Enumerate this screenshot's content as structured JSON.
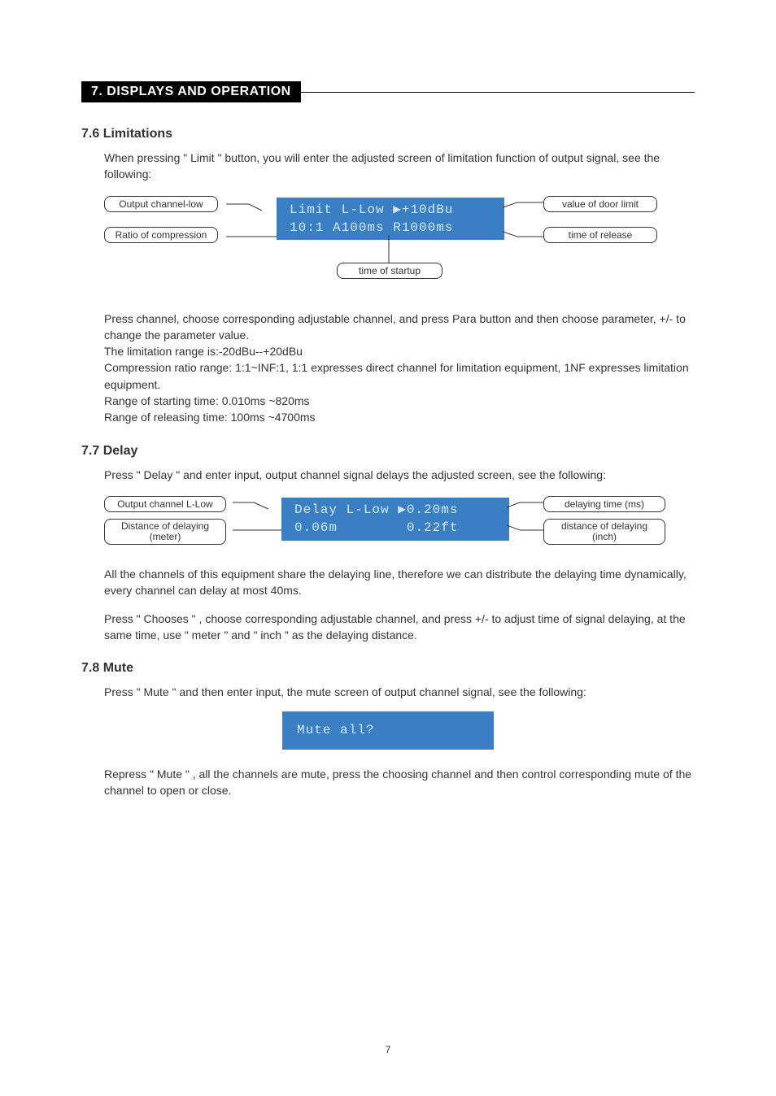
{
  "section_header": "7. DISPLAYS AND OPERATION",
  "limitations": {
    "title": "7.6 Limitations",
    "intro": "When pressing \" Limit \" button, you will enter the adjusted screen of limitation function of output signal, see the following:",
    "labels": {
      "out_channel": "Output channel-low",
      "ratio_comp": "Ratio of compression",
      "door_limit": "value of door limit",
      "time_release": "time of release",
      "time_startup": "time of startup"
    },
    "lcd_line1": "Limit L-Low ▶+10dBu",
    "lcd_line2": "10:1 A100ms R1000ms",
    "explain": "Press channel, choose corresponding adjustable channel, and press Para button and then choose parameter, +/- to change the parameter value.\nThe limitation range is:-20dBu--+20dBu\nCompression ratio range: 1:1~INF:1, 1:1 expresses direct channel for limitation equipment, 1NF expresses limitation equipment.\nRange of starting time: 0.010ms ~820ms\nRange of releasing time: 100ms ~4700ms"
  },
  "delay": {
    "title": "7.7 Delay",
    "intro": "Press \" Delay \" and enter input, output channel signal delays the adjusted screen, see the following:",
    "labels": {
      "out_channel": "Output channel L-Low",
      "dist_m": "Distance of delaying\n(meter)",
      "delay_time": "delaying time (ms)",
      "dist_in": "distance of delaying\n(inch)"
    },
    "lcd_line1": "Delay L-Low ▶0.20ms",
    "lcd_vals": {
      "m": "0.06m",
      "ft": "0.22ft"
    },
    "explain1": "All the channels of this equipment share the delaying line, therefore we can distribute the delaying time dynamically, every channel can delay at most 40ms.",
    "explain2": "Press \" Chooses \" , choose corresponding adjustable channel, and press +/- to adjust time of signal delaying, at the same time, use \" meter \" and \" inch \" as the delaying distance."
  },
  "mute": {
    "title": "7.8 Mute",
    "intro": "Press \" Mute \" and then enter input, the mute screen of output channel signal, see the following:",
    "lcd_line1": "Mute all?",
    "explain": "Repress \" Mute \" , all the channels are mute, press the choosing channel and then control corresponding mute of the channel to open or close."
  },
  "page_number": "7"
}
